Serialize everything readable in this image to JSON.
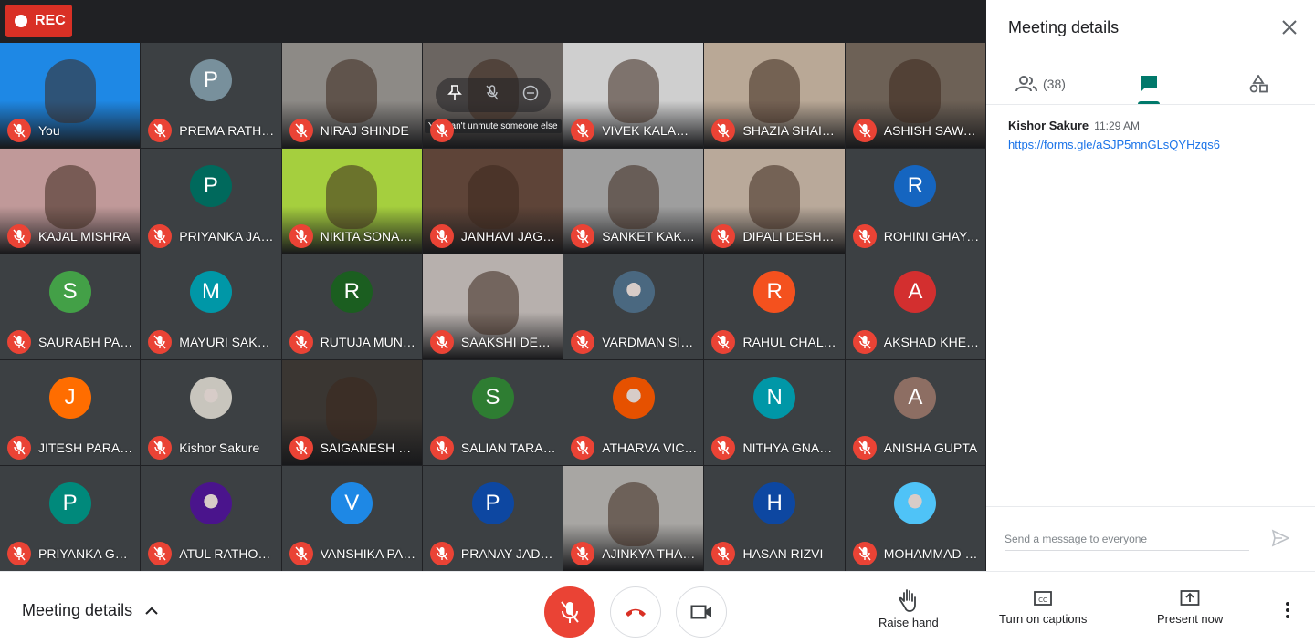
{
  "rec_label": "REC",
  "tooltip": "You can't unmute someone else",
  "participants": [
    {
      "name": "You",
      "type": "video",
      "bg": "#1e88e5",
      "initial": ""
    },
    {
      "name": "PREMA RATH…",
      "type": "avatar",
      "bg": "#78909c",
      "initial": "P"
    },
    {
      "name": "NIRAJ SHINDE",
      "type": "video",
      "bg": "#8d8a86",
      "initial": ""
    },
    {
      "name": "",
      "type": "video",
      "bg": "#6b6561",
      "initial": ""
    },
    {
      "name": "VIVEK KALAM…",
      "type": "video",
      "bg": "#cfcfcf",
      "initial": ""
    },
    {
      "name": "SHAZIA SHAIKH",
      "type": "video",
      "bg": "#b9a896",
      "initial": ""
    },
    {
      "name": "ASHISH SAWA…",
      "type": "video",
      "bg": "#6d6156",
      "initial": ""
    },
    {
      "name": "KAJAL MISHRA",
      "type": "video",
      "bg": "#c09999",
      "initial": ""
    },
    {
      "name": "PRIYANKA JA…",
      "type": "avatar",
      "bg": "#00695c",
      "initial": "P"
    },
    {
      "name": "NIKITA SONA…",
      "type": "video",
      "bg": "#a5cf3e",
      "initial": ""
    },
    {
      "name": "JANHAVI JAG…",
      "type": "video",
      "bg": "#5e4438",
      "initial": ""
    },
    {
      "name": "SANKET KAKA…",
      "type": "video",
      "bg": "#9e9e9e",
      "initial": ""
    },
    {
      "name": "DIPALI DESHM…",
      "type": "video",
      "bg": "#b9a99a",
      "initial": ""
    },
    {
      "name": "ROHINI GHAYAL",
      "type": "avatar",
      "bg": "#1565c0",
      "initial": "R"
    },
    {
      "name": "SAURABH PAS…",
      "type": "avatar",
      "bg": "#43a047",
      "initial": "S"
    },
    {
      "name": "MAYURI SAKP…",
      "type": "avatar",
      "bg": "#0097a7",
      "initial": "M"
    },
    {
      "name": "RUTUJA MUN…",
      "type": "avatar",
      "bg": "#1b5e20",
      "initial": "R"
    },
    {
      "name": "SAAKSHI DEO…",
      "type": "video",
      "bg": "#b7b0ad",
      "initial": ""
    },
    {
      "name": "VARDMAN SID…",
      "type": "photo",
      "bg": "#4a6880",
      "initial": ""
    },
    {
      "name": "RAHUL CHALKE",
      "type": "avatar",
      "bg": "#f4511e",
      "initial": "R"
    },
    {
      "name": "AKSHAD KHER…",
      "type": "avatar",
      "bg": "#d32f2f",
      "initial": "A"
    },
    {
      "name": "JITESH PARAP…",
      "type": "avatar",
      "bg": "#ff6d00",
      "initial": "J"
    },
    {
      "name": "Kishor Sakure",
      "type": "photo",
      "bg": "#c8c5bd",
      "initial": ""
    },
    {
      "name": "SAIGANESH N…",
      "type": "video",
      "bg": "#3a3632",
      "initial": ""
    },
    {
      "name": "SALIAN TARA…",
      "type": "avatar",
      "bg": "#2e7d32",
      "initial": "S"
    },
    {
      "name": "ATHARVA VIC…",
      "type": "photo",
      "bg": "#e65100",
      "initial": ""
    },
    {
      "name": "NITHYA GNAN…",
      "type": "avatar",
      "bg": "#0097a7",
      "initial": "N"
    },
    {
      "name": "ANISHA GUPTA",
      "type": "avatar",
      "bg": "#8d6e63",
      "initial": "A"
    },
    {
      "name": "PRIYANKA GATE",
      "type": "avatar",
      "bg": "#00897b",
      "initial": "P"
    },
    {
      "name": "ATUL RATHOUR",
      "type": "photo",
      "bg": "#4a148c",
      "initial": ""
    },
    {
      "name": "VANSHIKA PA…",
      "type": "avatar",
      "bg": "#1e88e5",
      "initial": "V"
    },
    {
      "name": "PRANAY JADH…",
      "type": "avatar",
      "bg": "#0d47a1",
      "initial": "P"
    },
    {
      "name": "AJINKYA THA…",
      "type": "video",
      "bg": "#a8a6a3",
      "initial": ""
    },
    {
      "name": "HASAN RIZVI",
      "type": "avatar",
      "bg": "#0d47a1",
      "initial": "H"
    },
    {
      "name": "MOHAMMAD …",
      "type": "photo",
      "bg": "#4fc3f7",
      "initial": ""
    }
  ],
  "sidebar": {
    "title": "Meeting details",
    "people_count": "(38)",
    "message": {
      "sender": "Kishor Sakure",
      "time": "11:29 AM",
      "link": "https://forms.gle/aSJP5mnGLsQYHzqs6"
    },
    "composer_placeholder": "Send a message to everyone"
  },
  "bottom": {
    "meeting_details": "Meeting details",
    "raise_hand": "Raise hand",
    "captions": "Turn on captions",
    "present": "Present now"
  },
  "colors": {
    "rec": "#d93025",
    "mute": "#ea4335",
    "accent": "#00796b",
    "link": "#1a73e8"
  }
}
